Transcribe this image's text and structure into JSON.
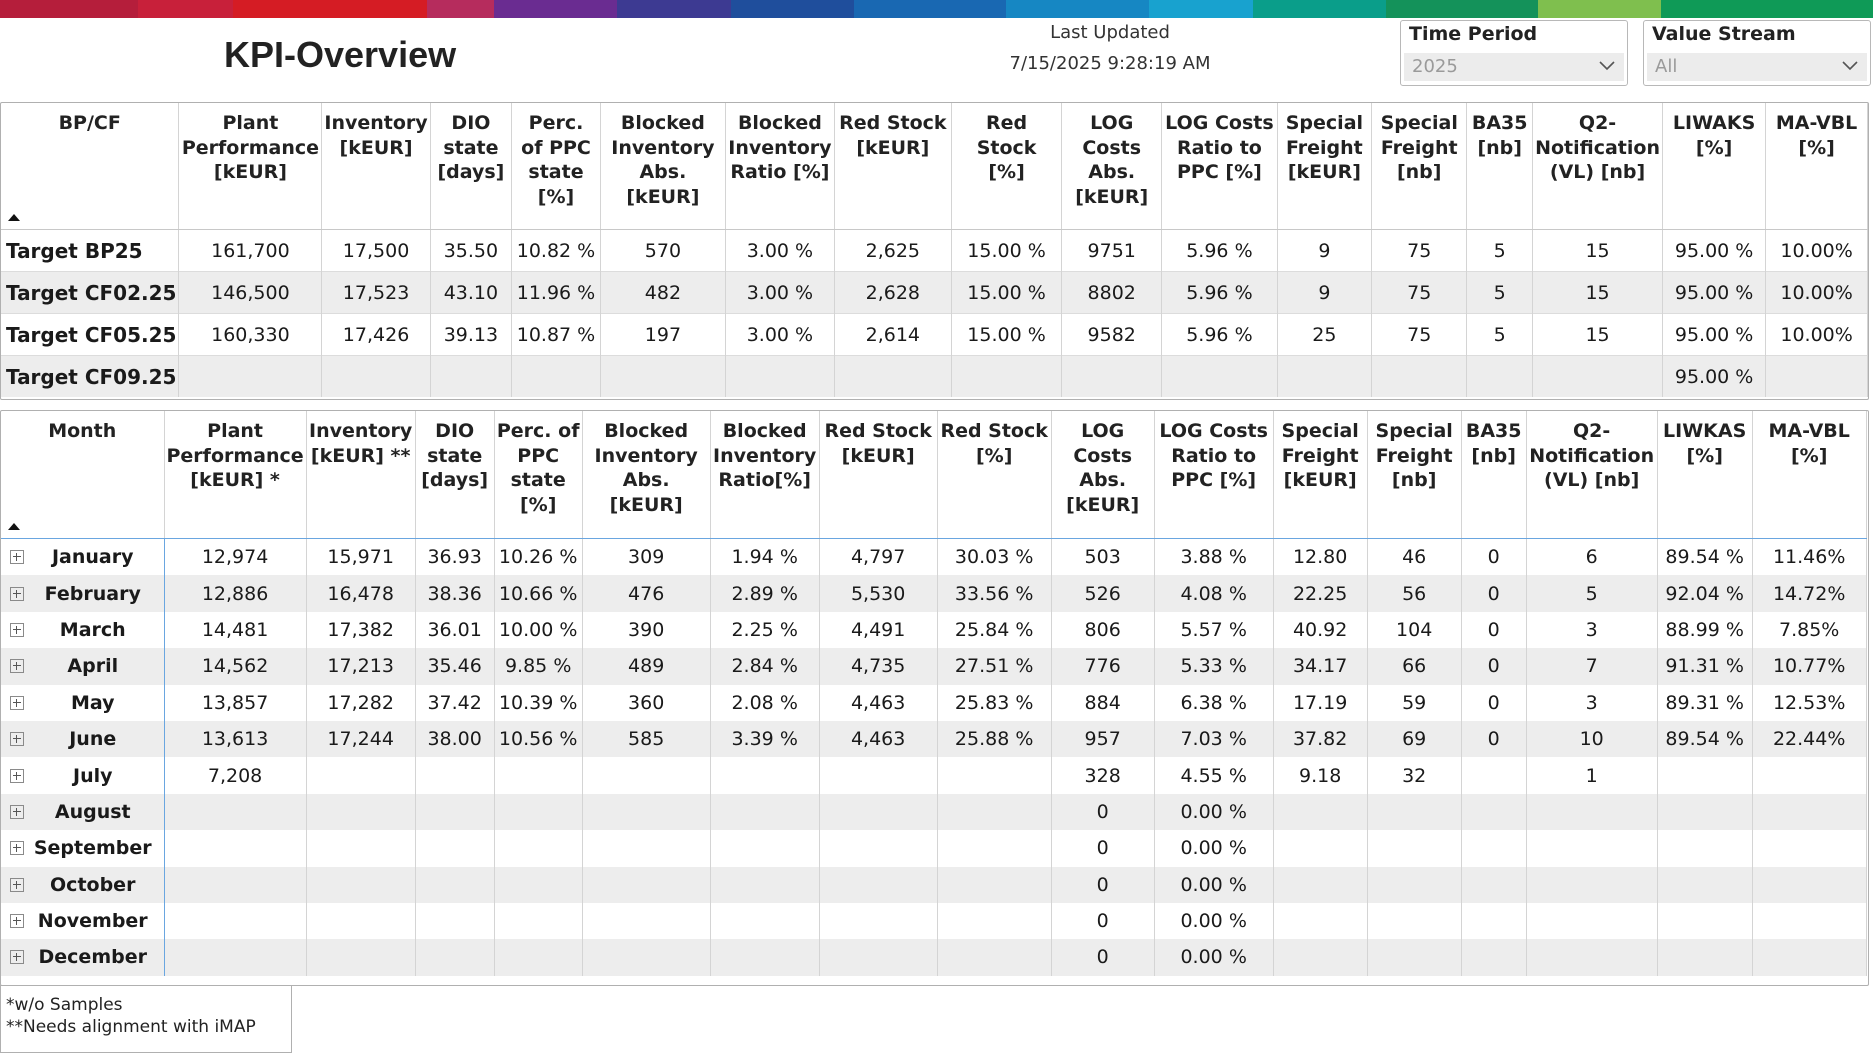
{
  "brand_bar_colors": [
    "#b51e3b",
    "#c8203a",
    "#d51c24",
    "#b62c5d",
    "#6a2c91",
    "#3d3a92",
    "#1f4e9c",
    "#1968b2",
    "#1687c3",
    "#18a2cf",
    "#0a9e8a",
    "#14925a",
    "#7fbf4e",
    "#0f9a57"
  ],
  "header": {
    "title": "KPI-Overview",
    "last_updated_label": "Last Updated",
    "last_updated_value": "7/15/2025 9:28:19 AM"
  },
  "slicers": {
    "time_period": {
      "label": "Time Period",
      "value": "2025",
      "icon": "chevron-down-icon"
    },
    "value_stream": {
      "label": "Value Stream",
      "value": "All",
      "icon": "chevron-down-icon"
    }
  },
  "targets_table": {
    "columns": [
      [
        "BP/CF"
      ],
      [
        "Plant",
        "Performance",
        "[kEUR]"
      ],
      [
        "Inventory",
        "[kEUR]"
      ],
      [
        "DIO",
        "state",
        "[days]"
      ],
      [
        "Perc.",
        "of PPC",
        "state",
        "[%]"
      ],
      [
        "Blocked",
        "Inventory",
        "Abs.",
        "[kEUR]"
      ],
      [
        "Blocked",
        "Inventory",
        "Ratio [%]"
      ],
      [
        "Red Stock",
        "[kEUR]"
      ],
      [
        "Red Stock",
        "[%]"
      ],
      [
        "LOG",
        "Costs",
        "Abs.",
        "[kEUR]"
      ],
      [
        "LOG Costs",
        "Ratio to",
        "PPC [%]"
      ],
      [
        "Special",
        "Freight",
        "[kEUR]"
      ],
      [
        "Special",
        "Freight",
        "[nb]"
      ],
      [
        "BA35",
        "[nb]"
      ],
      [
        "Q2-",
        "Notification",
        "(VL) [nb]"
      ],
      [
        "LIWAKS",
        "[%]"
      ],
      [
        "MA-VBL",
        "[%]"
      ]
    ],
    "rows": [
      [
        "Target BP25",
        "161,700",
        "17,500",
        "35.50",
        "10.82 %",
        "570",
        "3.00 %",
        "2,625",
        "15.00 %",
        "9751",
        "5.96 %",
        "9",
        "75",
        "5",
        "15",
        "95.00 %",
        "10.00%"
      ],
      [
        "Target CF02.25",
        "146,500",
        "17,523",
        "43.10",
        "11.96 %",
        "482",
        "3.00 %",
        "2,628",
        "15.00 %",
        "8802",
        "5.96 %",
        "9",
        "75",
        "5",
        "15",
        "95.00 %",
        "10.00%"
      ],
      [
        "Target CF05.25",
        "160,330",
        "17,426",
        "39.13",
        "10.87 %",
        "197",
        "3.00 %",
        "2,614",
        "15.00 %",
        "9582",
        "5.96 %",
        "25",
        "75",
        "5",
        "15",
        "95.00 %",
        "10.00%"
      ],
      [
        "Target CF09.25",
        "",
        "",
        "",
        "",
        "",
        "",
        "",
        "",
        "",
        "",
        "",
        "",
        "",
        "",
        "95.00 %",
        ""
      ]
    ]
  },
  "months_table": {
    "columns": [
      [
        "Month"
      ],
      [
        "Plant",
        "Performance",
        "[kEUR] *"
      ],
      [
        "Inventory",
        "[kEUR] **"
      ],
      [
        "DIO",
        "state",
        "[days]"
      ],
      [
        "Perc. of",
        "PPC",
        "state",
        "[%]"
      ],
      [
        "Blocked",
        "Inventory",
        "Abs.",
        "[kEUR]"
      ],
      [
        "Blocked",
        "Inventory",
        "Ratio[%]"
      ],
      [
        "Red Stock",
        "[kEUR]"
      ],
      [
        "Red Stock",
        "[%]"
      ],
      [
        "LOG",
        "Costs",
        "Abs.",
        "[kEUR]"
      ],
      [
        "LOG Costs",
        "Ratio to",
        "PPC [%]"
      ],
      [
        "Special",
        "Freight",
        "[kEUR]"
      ],
      [
        "Special",
        "Freight",
        "[nb]"
      ],
      [
        "BA35",
        "[nb]"
      ],
      [
        "Q2-",
        "Notification",
        "(VL) [nb]"
      ],
      [
        "LIWKAS",
        "[%]"
      ],
      [
        "MA-VBL",
        "[%]"
      ]
    ],
    "rows": [
      [
        "January",
        "12,974",
        "15,971",
        "36.93",
        "10.26 %",
        "309",
        "1.94 %",
        "4,797",
        "30.03 %",
        "503",
        "3.88 %",
        "12.80",
        "46",
        "0",
        "6",
        "89.54 %",
        "11.46%"
      ],
      [
        "February",
        "12,886",
        "16,478",
        "38.36",
        "10.66 %",
        "476",
        "2.89 %",
        "5,530",
        "33.56 %",
        "526",
        "4.08 %",
        "22.25",
        "56",
        "0",
        "5",
        "92.04 %",
        "14.72%"
      ],
      [
        "March",
        "14,481",
        "17,382",
        "36.01",
        "10.00 %",
        "390",
        "2.25 %",
        "4,491",
        "25.84 %",
        "806",
        "5.57 %",
        "40.92",
        "104",
        "0",
        "3",
        "88.99 %",
        "7.85%"
      ],
      [
        "April",
        "14,562",
        "17,213",
        "35.46",
        "9.85 %",
        "489",
        "2.84 %",
        "4,735",
        "27.51 %",
        "776",
        "5.33 %",
        "34.17",
        "66",
        "0",
        "7",
        "91.31 %",
        "10.77%"
      ],
      [
        "May",
        "13,857",
        "17,282",
        "37.42",
        "10.39 %",
        "360",
        "2.08 %",
        "4,463",
        "25.83 %",
        "884",
        "6.38 %",
        "17.19",
        "59",
        "0",
        "3",
        "89.31 %",
        "12.53%"
      ],
      [
        "June",
        "13,613",
        "17,244",
        "38.00",
        "10.56 %",
        "585",
        "3.39 %",
        "4,463",
        "25.88 %",
        "957",
        "7.03 %",
        "37.82",
        "69",
        "0",
        "10",
        "89.54 %",
        "22.44%"
      ],
      [
        "July",
        "7,208",
        "",
        "",
        "",
        "",
        "",
        "",
        "",
        "328",
        "4.55 %",
        "9.18",
        "32",
        "",
        "1",
        "",
        ""
      ],
      [
        "August",
        "",
        "",
        "",
        "",
        "",
        "",
        "",
        "",
        "0",
        "0.00 %",
        "",
        "",
        "",
        "",
        "",
        ""
      ],
      [
        "September",
        "",
        "",
        "",
        "",
        "",
        "",
        "",
        "",
        "0",
        "0.00 %",
        "",
        "",
        "",
        "",
        "",
        ""
      ],
      [
        "October",
        "",
        "",
        "",
        "",
        "",
        "",
        "",
        "",
        "0",
        "0.00 %",
        "",
        "",
        "",
        "",
        "",
        ""
      ],
      [
        "November",
        "",
        "",
        "",
        "",
        "",
        "",
        "",
        "",
        "0",
        "0.00 %",
        "",
        "",
        "",
        "",
        "",
        ""
      ],
      [
        "December",
        "",
        "",
        "",
        "",
        "",
        "",
        "",
        "",
        "0",
        "0.00 %",
        "",
        "",
        "",
        "",
        "",
        ""
      ]
    ]
  },
  "footnotes": [
    "*w/o Samples",
    "**Needs alignment with iMAP"
  ]
}
